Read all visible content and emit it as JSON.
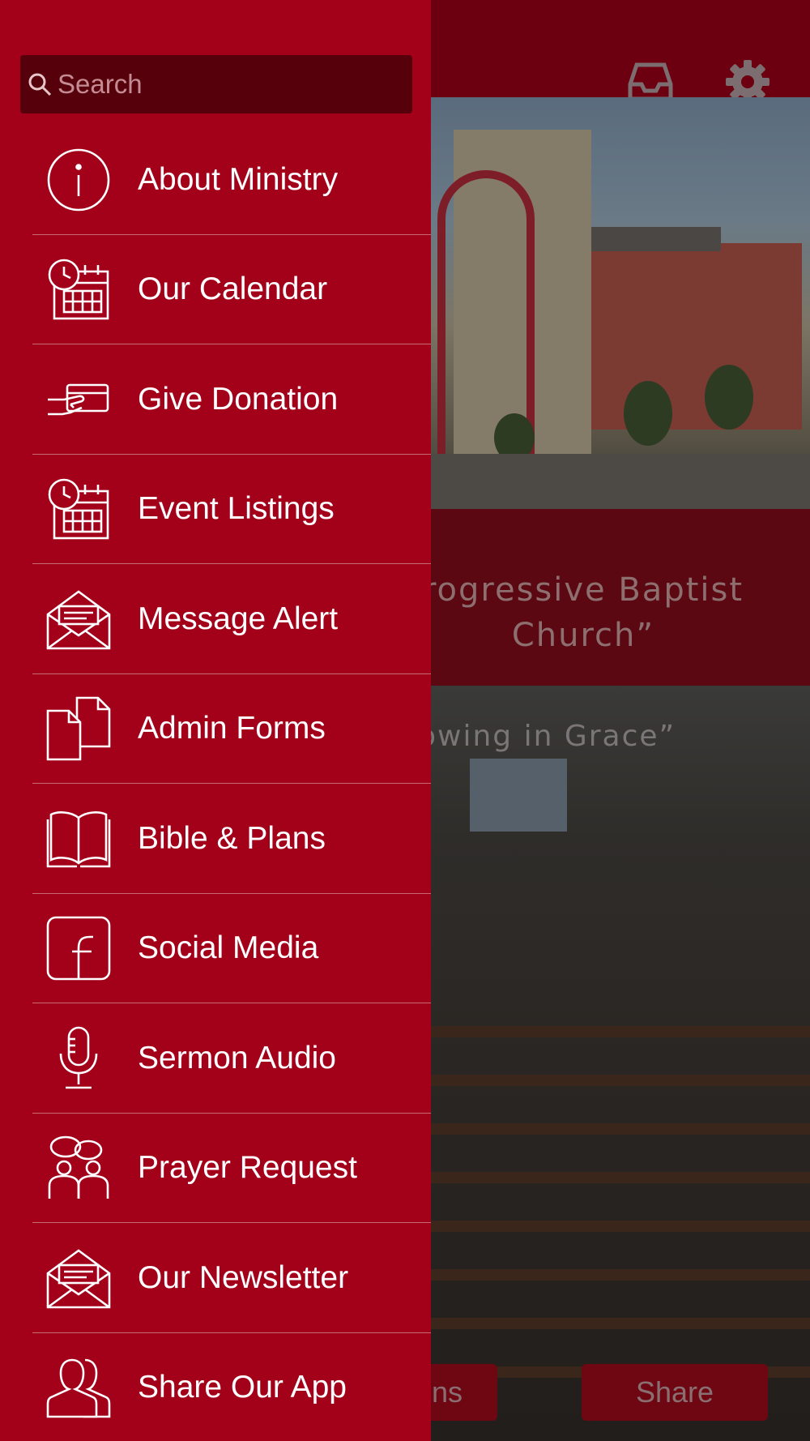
{
  "colors": {
    "drawer_bg": "#a3001a",
    "search_bg": "#56000c",
    "divider": "#c66a76",
    "topbar_bg": "#6c0010"
  },
  "background": {
    "title_fragment": "rogressive Baptist\nChurch”",
    "subtitle_fragment": "rowing in Grace”",
    "bottom_buttons": [
      "ons",
      "Share"
    ],
    "topbar_icons": [
      "inbox-icon",
      "gear-icon"
    ]
  },
  "drawer": {
    "search": {
      "placeholder": "Search",
      "value": ""
    },
    "items": [
      {
        "label": "About Ministry",
        "icon": "info-icon"
      },
      {
        "label": "Our Calendar",
        "icon": "calendar-clock-icon"
      },
      {
        "label": "Give Donation",
        "icon": "donation-hand-card-icon"
      },
      {
        "label": "Event Listings",
        "icon": "calendar-clock-icon"
      },
      {
        "label": "Message Alert",
        "icon": "envelope-open-icon"
      },
      {
        "label": "Admin Forms",
        "icon": "documents-icon"
      },
      {
        "label": "Bible & Plans",
        "icon": "open-book-icon"
      },
      {
        "label": "Social Media",
        "icon": "facebook-icon"
      },
      {
        "label": "Sermon Audio",
        "icon": "microphone-icon"
      },
      {
        "label": "Prayer Request",
        "icon": "people-chat-icon"
      },
      {
        "label": "Our Newsletter",
        "icon": "envelope-open-icon"
      },
      {
        "label": "Share Our App",
        "icon": "people-share-icon"
      }
    ]
  }
}
